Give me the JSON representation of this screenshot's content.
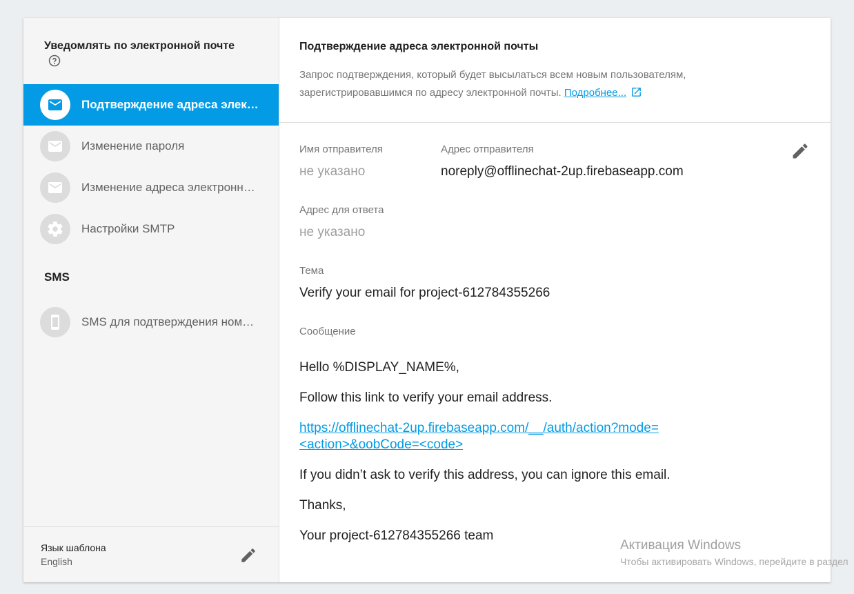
{
  "sidebar": {
    "email_heading": "Уведомлять по электронной почте",
    "help_icon": "help-circle-icon",
    "email_items": [
      {
        "label": "Подтверждение адреса элек…",
        "icon": "mail-icon",
        "active": true
      },
      {
        "label": "Изменение пароля",
        "icon": "mail-icon",
        "active": false
      },
      {
        "label": "Изменение адреса электронн…",
        "icon": "mail-icon",
        "active": false
      },
      {
        "label": "Настройки SMTP",
        "icon": "gear-icon",
        "active": false
      }
    ],
    "sms_heading": "SMS",
    "sms_items": [
      {
        "label": "SMS для подтверждения ном…",
        "icon": "phone-icon",
        "active": false
      }
    ],
    "footer": {
      "label": "Язык шаблона",
      "value": "English"
    }
  },
  "main": {
    "title": "Подтверждение адреса электронной почты",
    "description_line1": "Запрос подтверждения, который будет высылаться всем новым пользователям,",
    "description_line2": "зарегистрировавшимся по адресу электронной почты.",
    "learn_more": "Подробнее...",
    "fields": {
      "sender_name_label": "Имя отправителя",
      "sender_name_value": "не указано",
      "sender_address_label": "Адрес отправителя",
      "sender_address_value": "noreply@offlinechat-2up.firebaseapp.com",
      "reply_to_label": "Адрес для ответа",
      "reply_to_value": "не указано",
      "subject_label": "Тема",
      "subject_value": "Verify your email for project-612784355266",
      "message_label": "Сообщение"
    },
    "message": {
      "greeting": "Hello %DISPLAY_NAME%,",
      "instruction": "Follow this link to verify your email address.",
      "link_line1": "https://offlinechat-2up.firebaseapp.com/__/auth/action?mode=",
      "link_line2": "<action>&oobCode=<code>",
      "ignore": "If you didn’t ask to verify this address, you can ignore this email.",
      "thanks": "Thanks,",
      "signature": "Your project-612784355266 team"
    }
  },
  "watermark": {
    "title": "Активация Windows",
    "subtitle": "Чтобы активировать Windows, перейдите в раздел"
  },
  "colors": {
    "accent": "#039be5",
    "background": "#eceff1",
    "sidebar": "#f5f5f5"
  }
}
